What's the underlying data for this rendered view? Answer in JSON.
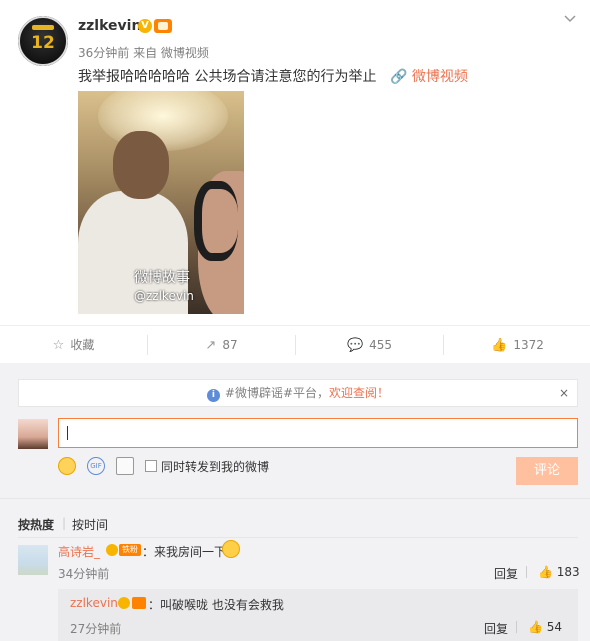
{
  "post": {
    "username": "zzlkevin",
    "verified_mark": "V",
    "avatar_number": "12",
    "meta": "36分钟前 来自 微博视频",
    "text": "我举报哈哈哈哈哈 公共场合请注意您的行为举止",
    "link_label": "微博视频",
    "watermark_title": "微博故事",
    "watermark_handle": "@zzlkevin"
  },
  "actions": {
    "favorite_label": "收藏",
    "repost_count": "87",
    "comment_count": "455",
    "like_count": "1372"
  },
  "notice": {
    "text_prefix": "#微博辟谣#平台，",
    "text_highlight": "欢迎查阅！",
    "close": "×"
  },
  "composer": {
    "gif_label": "GIF",
    "repost_checkbox_label": "同时转发到我的微博",
    "submit_label": "评论"
  },
  "sort": {
    "by_hot": "按热度",
    "separator": "|",
    "by_time": "按时间"
  },
  "comments": [
    {
      "name": "高诗岩_",
      "tag": "铁粉",
      "text": "：来我房间一下",
      "time": "34分钟前",
      "reply_label": "回复",
      "likes": "183",
      "reply": {
        "name": "zzlkevin",
        "text": "：叫破喉咙 也没有会救我",
        "time": "27分钟前",
        "reply_label": "回复",
        "likes": "54"
      }
    }
  ],
  "colors": {
    "accent": "#eb7350",
    "input_border": "#fa7d3c",
    "submit_disabled": "#ffc09f",
    "verified": "#f7b500"
  }
}
